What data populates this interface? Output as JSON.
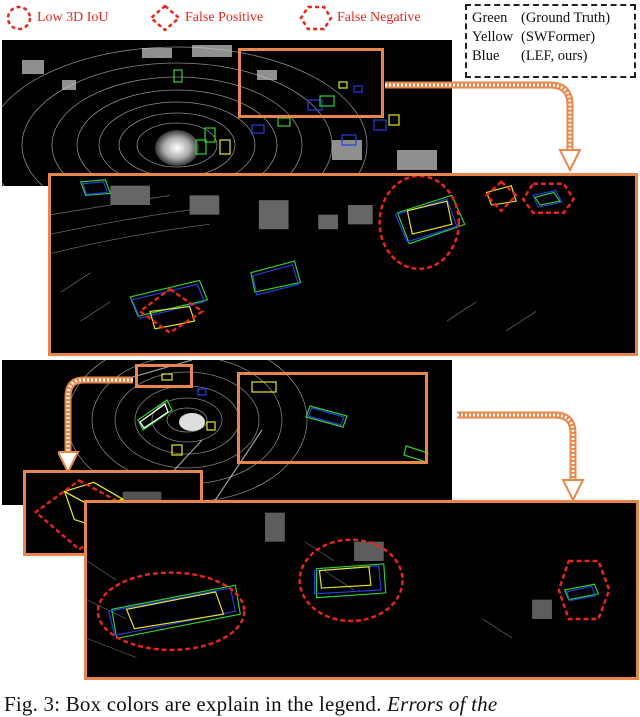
{
  "figure": {
    "error_legend": [
      {
        "shape": "dashed-circle-icon",
        "label": "Low 3D IoU"
      },
      {
        "shape": "dashed-diamond-icon",
        "label": "False Positive"
      },
      {
        "shape": "dashed-hexagon-icon",
        "label": "False Negative"
      }
    ],
    "color_key": [
      {
        "color_name": "Green",
        "meaning": "(Ground Truth)"
      },
      {
        "color_name": "Yellow",
        "meaning": "(SWFormer)"
      },
      {
        "color_name": "Blue",
        "meaning": "(LEF, ours)"
      }
    ],
    "colors": {
      "ground_truth": "#2fd12f",
      "swformer": "#e6e62a",
      "lef": "#2a3ce0",
      "error_marker": "#e8261e",
      "zoom_frame": "#e8874a",
      "background": "#000000"
    },
    "caption": {
      "prefix": "Fig. 3: Box colors are explain in the legend. ",
      "italic": "Errors of the"
    }
  }
}
